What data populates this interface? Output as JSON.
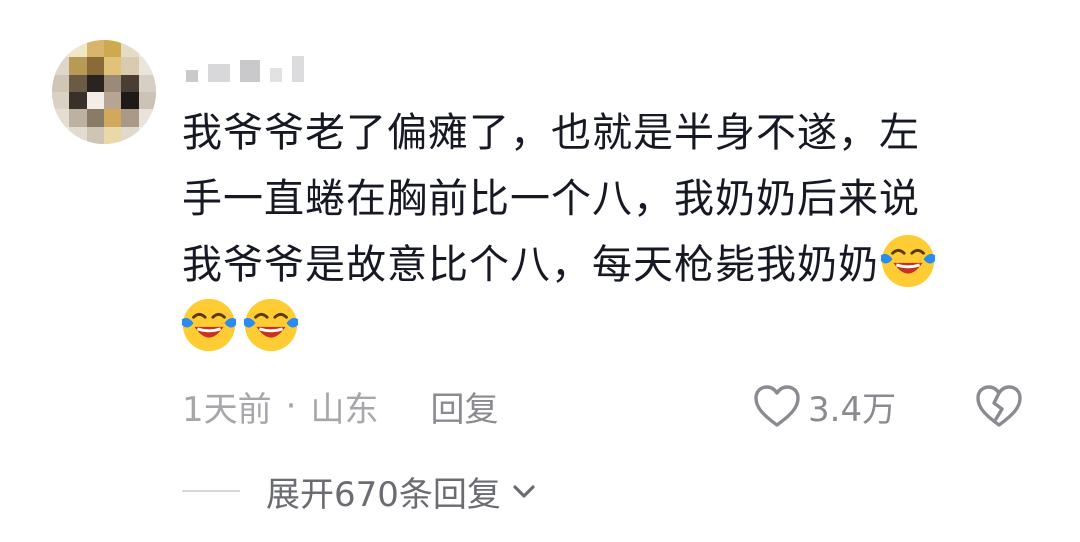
{
  "comment": {
    "body_line1": "我爷爷老了偏瘫了，也就是半身不遂，左",
    "body_line2": "手一直蜷在胸前比一个八，我奶奶后来说",
    "body_line3": "我爷爷是故意比个八，每天枪毙我奶奶",
    "emojis": [
      "laugh-cry-emoji",
      "laugh-cry-emoji",
      "laugh-cry-emoji"
    ],
    "time": "1天前",
    "separator": "·",
    "location": "山东",
    "reply_label": "回复",
    "like_count": "3.4万",
    "expand_label": "展开670条回复"
  },
  "colors": {
    "text": "#161823",
    "meta": "#a6a7ab",
    "icon": "#8a8b91",
    "emoji_face": "#ffcc33",
    "emoji_tears": "#2b8cf0",
    "emoji_mouth": "#c7311f"
  }
}
